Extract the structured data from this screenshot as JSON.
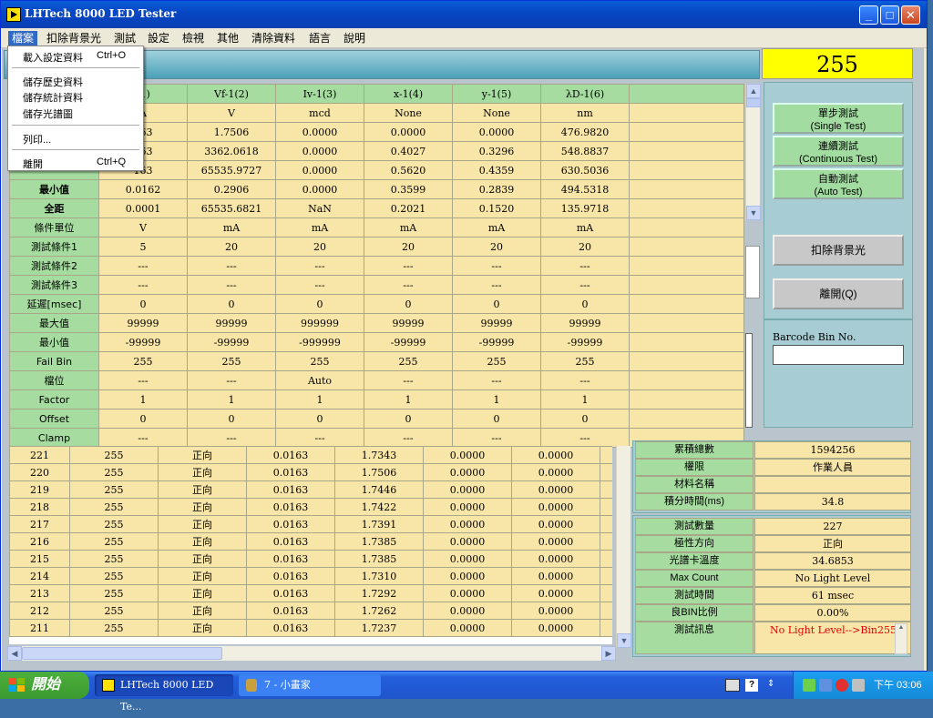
{
  "window": {
    "title": "LHTech 8000 LED Tester",
    "minimize": "_",
    "maximize": "□",
    "close": "✕"
  },
  "menubar": [
    "檔案",
    "扣除背景光",
    "測試",
    "設定",
    "檢視",
    "其他",
    "清除資料",
    "語言",
    "說明"
  ],
  "dropdown": {
    "items": [
      {
        "label": "載入設定資料",
        "shortcut": "Ctrl+O"
      },
      {
        "label": "儲存歷史資料",
        "shortcut": ""
      },
      {
        "label": "儲存統計資料",
        "shortcut": ""
      },
      {
        "label": "儲存光譜圖",
        "shortcut": ""
      },
      {
        "label": "列印...",
        "shortcut": ""
      },
      {
        "label": "離開",
        "shortcut": "Ctrl+Q"
      }
    ]
  },
  "counter": "255",
  "upper_table": {
    "headers": [
      "",
      "(1)",
      "Vf-1(2)",
      "Iv-1(3)",
      "x-1(4)",
      "y-1(5)",
      "λD-1(6)",
      ""
    ],
    "rows": [
      [
        "",
        "A",
        "V",
        "mcd",
        "None",
        "None",
        "nm",
        ""
      ],
      [
        "",
        "163",
        "1.7506",
        "0.0000",
        "0.0000",
        "0.0000",
        "476.9820",
        ""
      ],
      [
        "",
        "163",
        "3362.0618",
        "0.0000",
        "0.4027",
        "0.3296",
        "548.8837",
        ""
      ],
      [
        "",
        "163",
        "65535.9727",
        "0.0000",
        "0.5620",
        "0.4359",
        "630.5036",
        ""
      ],
      [
        "最小值",
        "0.0162",
        "0.2906",
        "0.0000",
        "0.3599",
        "0.2839",
        "494.5318",
        ""
      ],
      [
        "全距",
        "0.0001",
        "65535.6821",
        "NaN",
        "0.2021",
        "0.1520",
        "135.9718",
        ""
      ],
      [
        "條件單位",
        "V",
        "mA",
        "mA",
        "mA",
        "mA",
        "mA",
        ""
      ],
      [
        "測試條件1",
        "5",
        "20",
        "20",
        "20",
        "20",
        "20",
        ""
      ],
      [
        "測試條件2",
        "---",
        "---",
        "---",
        "---",
        "---",
        "---",
        ""
      ],
      [
        "測試條件3",
        "---",
        "---",
        "---",
        "---",
        "---",
        "---",
        ""
      ],
      [
        "延遲[msec]",
        "0",
        "0",
        "0",
        "0",
        "0",
        "0",
        ""
      ],
      [
        "最大值",
        "99999",
        "99999",
        "999999",
        "99999",
        "99999",
        "99999",
        ""
      ],
      [
        "最小值",
        "-99999",
        "-99999",
        "-999999",
        "-99999",
        "-99999",
        "-99999",
        ""
      ],
      [
        "Fail Bin",
        "255",
        "255",
        "255",
        "255",
        "255",
        "255",
        ""
      ],
      [
        "檔位",
        "---",
        "---",
        "Auto",
        "---",
        "---",
        "---",
        ""
      ],
      [
        "Factor",
        "1",
        "1",
        "1",
        "1",
        "1",
        "1",
        ""
      ],
      [
        "Offset",
        "0",
        "0",
        "0",
        "0",
        "0",
        "0",
        ""
      ],
      [
        "Clamp",
        "---",
        "---",
        "---",
        "---",
        "---",
        "---",
        ""
      ]
    ]
  },
  "lower_table": {
    "rows": [
      [
        "221",
        "255",
        "正向",
        "0.0163",
        "1.7343",
        "0.0000",
        "0.0000"
      ],
      [
        "220",
        "255",
        "正向",
        "0.0163",
        "1.7506",
        "0.0000",
        "0.0000"
      ],
      [
        "219",
        "255",
        "正向",
        "0.0163",
        "1.7446",
        "0.0000",
        "0.0000"
      ],
      [
        "218",
        "255",
        "正向",
        "0.0163",
        "1.7422",
        "0.0000",
        "0.0000"
      ],
      [
        "217",
        "255",
        "正向",
        "0.0163",
        "1.7391",
        "0.0000",
        "0.0000"
      ],
      [
        "216",
        "255",
        "正向",
        "0.0163",
        "1.7385",
        "0.0000",
        "0.0000"
      ],
      [
        "215",
        "255",
        "正向",
        "0.0163",
        "1.7385",
        "0.0000",
        "0.0000"
      ],
      [
        "214",
        "255",
        "正向",
        "0.0163",
        "1.7310",
        "0.0000",
        "0.0000"
      ],
      [
        "213",
        "255",
        "正向",
        "0.0163",
        "1.7292",
        "0.0000",
        "0.0000"
      ],
      [
        "212",
        "255",
        "正向",
        "0.0163",
        "1.7262",
        "0.0000",
        "0.0000"
      ],
      [
        "211",
        "255",
        "正向",
        "0.0163",
        "1.7237",
        "0.0000",
        "0.0000"
      ]
    ]
  },
  "buttons": {
    "single": {
      "line1": "單步測試",
      "line2": "(Single Test)"
    },
    "continuous": {
      "line1": "連續測試",
      "line2": "(Continuous Test)"
    },
    "auto": {
      "line1": "自動測試",
      "line2": "(Auto Test)"
    },
    "background": "扣除背景光",
    "exit": "離開(Q)"
  },
  "barcode_label": "Barcode Bin No.",
  "info1": [
    {
      "label": "累積總數",
      "value": "1594256"
    },
    {
      "label": "權限",
      "value": "作業人員"
    },
    {
      "label": "材料名稱",
      "value": ""
    },
    {
      "label": "積分時間(ms)",
      "value": "34.8"
    }
  ],
  "info2": [
    {
      "label": "測試數量",
      "value": "227"
    },
    {
      "label": "極性方向",
      "value": "正向"
    },
    {
      "label": "光譜卡溫度",
      "value": "34.6853"
    },
    {
      "label": "Max Count",
      "value": "No Light Level"
    },
    {
      "label": "測試時間",
      "value": "61  msec"
    },
    {
      "label": "良BIN比例",
      "value": "0.00%"
    },
    {
      "label": "測試訊息",
      "value": "No Light Level-->Bin255"
    }
  ],
  "taskbar": {
    "start": "開始",
    "task1": "LHTech 8000 LED Te...",
    "task2": "7 - 小畫家",
    "clock": "下午 03:06"
  },
  "colors": {
    "header_green": "#a6dca0",
    "cell_yellow": "#f8e6a8",
    "counter_yellow": "#ffff00",
    "alert_red": "#e00000"
  }
}
